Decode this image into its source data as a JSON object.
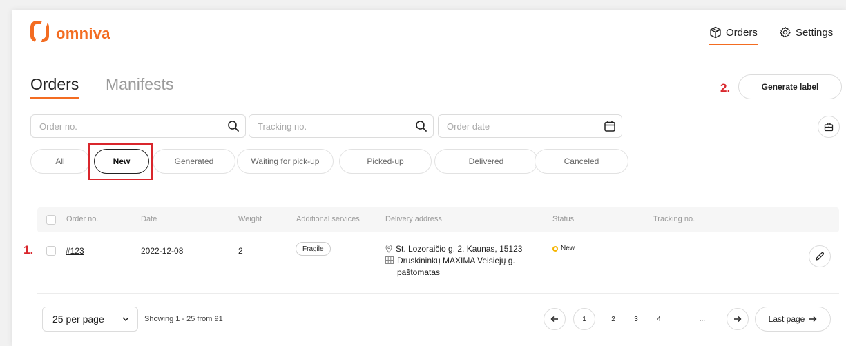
{
  "header": {
    "brand": "omniva",
    "nav": [
      {
        "label": "Orders",
        "icon": "package-icon",
        "active": true
      },
      {
        "label": "Settings",
        "icon": "gear-icon"
      }
    ]
  },
  "tabs": [
    {
      "label": "Orders",
      "active": true
    },
    {
      "label": "Manifests"
    }
  ],
  "annotations": {
    "step1": "1.",
    "step2": "2."
  },
  "actions": {
    "generate_label": "Generate label"
  },
  "search": {
    "order_no_placeholder": "Order no.",
    "tracking_no_placeholder": "Tracking no.",
    "order_date_placeholder": "Order date"
  },
  "filters": [
    {
      "label": "All"
    },
    {
      "label": "New",
      "active": true
    },
    {
      "label": "Generated"
    },
    {
      "label": "Waiting for pick-up"
    },
    {
      "label": "Picked-up"
    },
    {
      "label": "Delivered"
    },
    {
      "label": "Canceled"
    }
  ],
  "table": {
    "columns": [
      "Order no.",
      "Date",
      "Weight",
      "Additional services",
      "Delivery address",
      "Status",
      "Tracking no."
    ],
    "rows": [
      {
        "order_no": "#123",
        "date": "2022-12-08",
        "weight": "2",
        "service": "Fragile",
        "address_line1": "St. Lozoraičio g. 2, Kaunas, 15123",
        "address_line2": "Druskininkų MAXIMA Veisiejų g. paštomatas",
        "status": "New",
        "status_color": "#f5b400",
        "tracking_no": ""
      }
    ]
  },
  "pagination": {
    "per_page": "25 per page",
    "showing": "Showing 1 - 25 from 91",
    "pages": [
      "1",
      "2",
      "3",
      "4",
      "..."
    ],
    "current": "1",
    "last_page": "Last page"
  },
  "colors": {
    "brand": "#f36c21",
    "highlight": "#d9262c"
  }
}
